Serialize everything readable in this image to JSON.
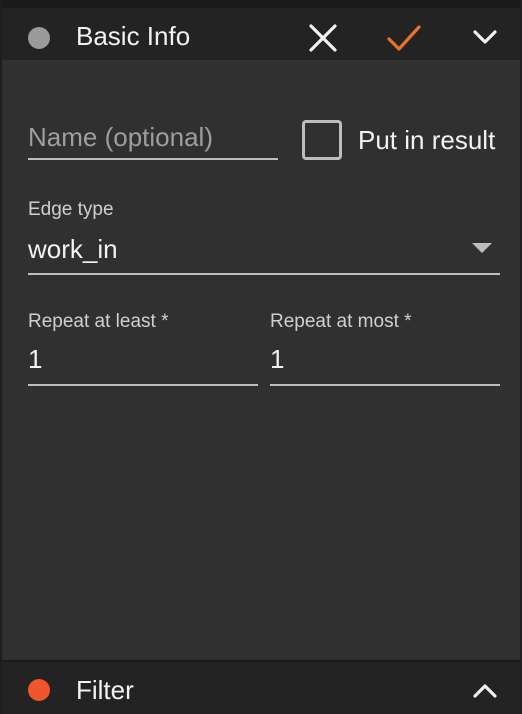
{
  "header": {
    "title": "Basic Info",
    "status_dot_color": "#9a9a9a",
    "icons": [
      "close-icon",
      "check-icon",
      "chevron-down-icon"
    ],
    "check_color": "#e8742a"
  },
  "form": {
    "name_placeholder": "Name (optional)",
    "name_value": "",
    "put_in_result_label": "Put in result",
    "put_in_result_checked": false,
    "edge_type_label": "Edge type",
    "edge_type_value": "work_in",
    "repeat_at_least_label": "Repeat at least *",
    "repeat_at_least_value": "1",
    "repeat_at_most_label": "Repeat at most *",
    "repeat_at_most_value": "1"
  },
  "footer": {
    "title": "Filter",
    "status_dot_color": "#f0552b",
    "icons": [
      "chevron-up-icon"
    ]
  }
}
